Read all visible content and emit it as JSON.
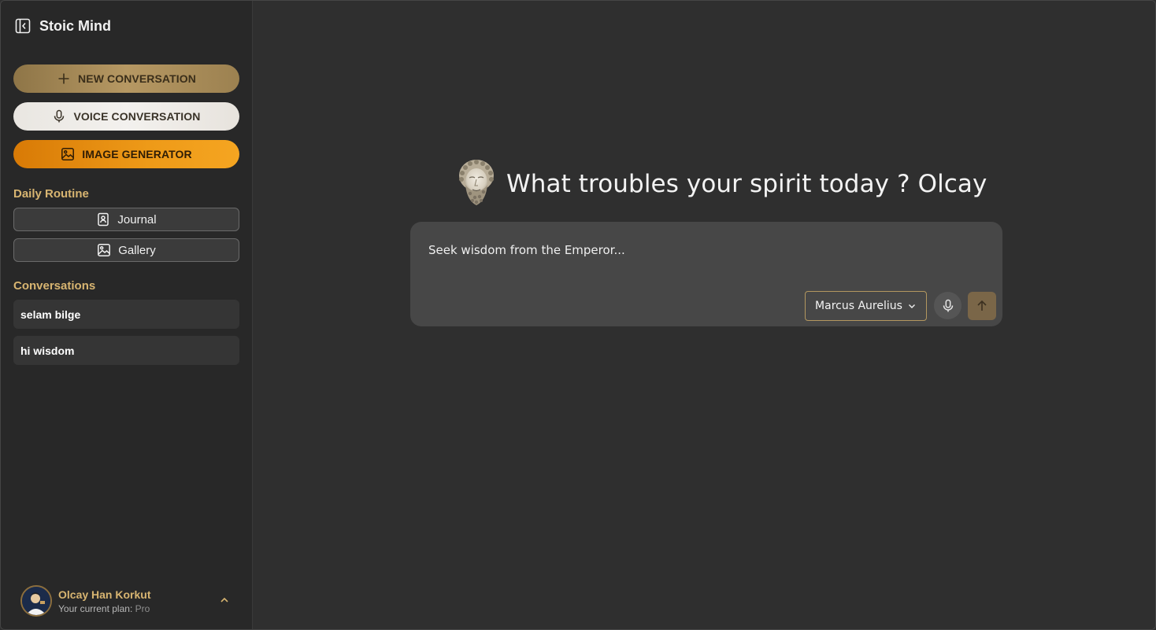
{
  "app": {
    "name": "Stoic Mind",
    "icons": {
      "sidebar_toggle": "sidebar-collapse-icon",
      "new": "plus-icon",
      "voice": "microphone-icon",
      "image": "image-icon",
      "journal": "journal-icon",
      "gallery": "gallery-icon",
      "user_menu": "chevron-up-icon",
      "model_dropdown": "chevron-down-icon",
      "send": "arrow-up-icon",
      "bust": "marcus-aurelius-bust-icon"
    }
  },
  "sidebar": {
    "new_conversation": "NEW CONVERSATION",
    "voice_conversation": "VOICE CONVERSATION",
    "image_generator": "IMAGE GENERATOR",
    "daily_routine": {
      "title": "Daily Routine",
      "items": [
        {
          "label": "Journal"
        },
        {
          "label": "Gallery"
        }
      ]
    },
    "conversations": {
      "title": "Conversations",
      "items": [
        {
          "label": "selam bilge"
        },
        {
          "label": "hi wisdom"
        }
      ]
    },
    "user": {
      "name": "Olcay Han Korkut",
      "plan_label": "Your current plan: ",
      "plan_value": "Pro"
    }
  },
  "main": {
    "greeting": "What troubles your spirit today ? Olcay",
    "composer": {
      "placeholder": "Seek wisdom from the Emperor...",
      "value": "",
      "model": "Marcus Aurelius"
    }
  },
  "colors": {
    "accent_gold": "#d8b571",
    "new_button": "#b69863",
    "image_button": "#ee9a18",
    "send_button": "#7a6648",
    "background": "#2f2f2f",
    "sidebar": "#282828"
  }
}
